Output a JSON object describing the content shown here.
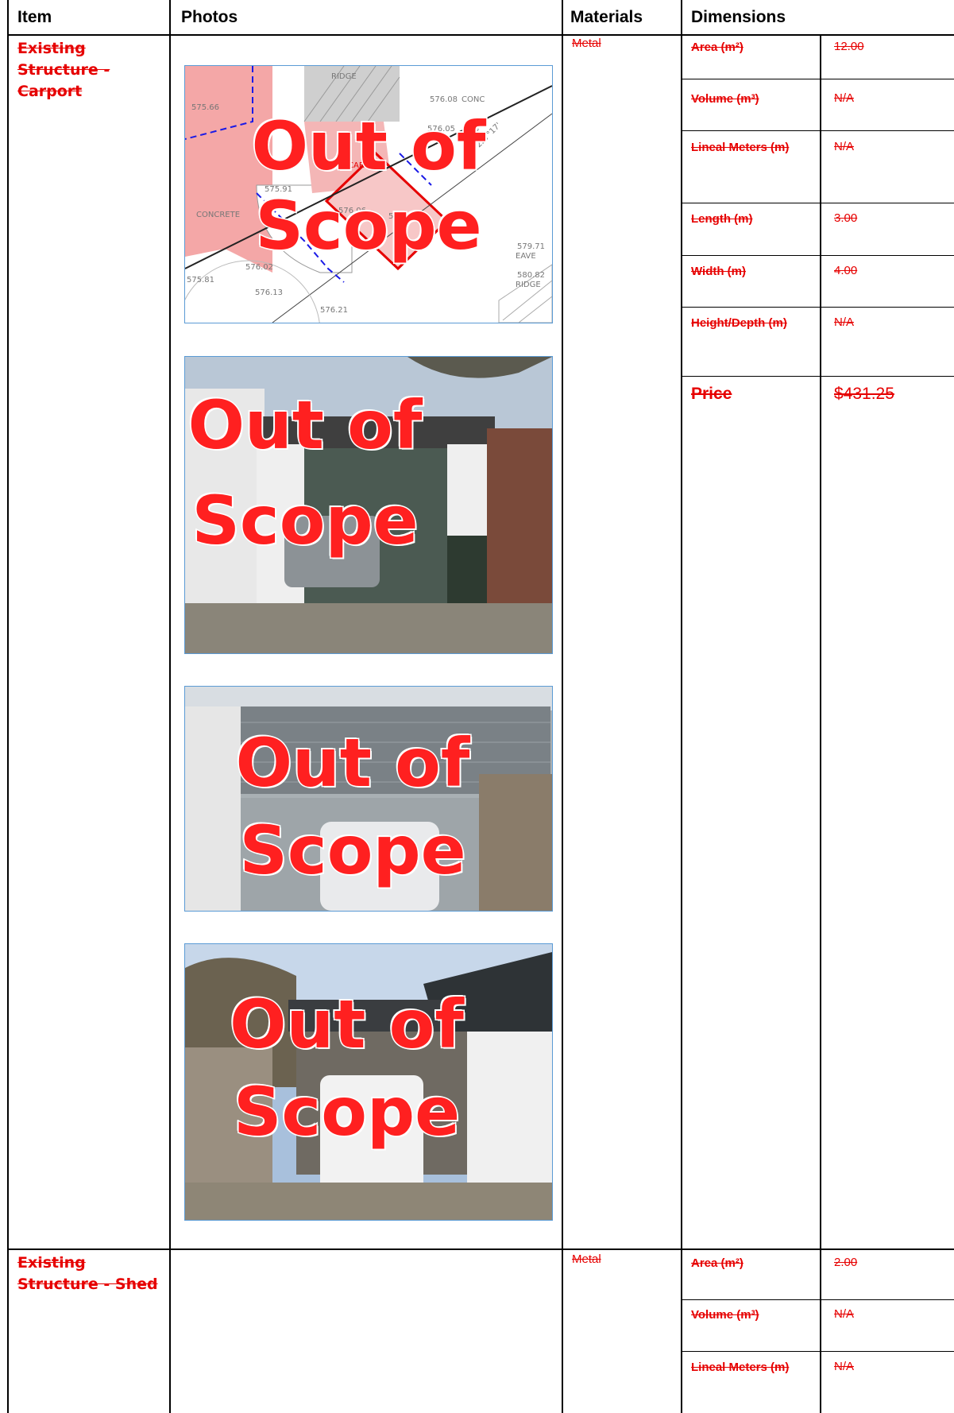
{
  "headers": {
    "item": "Item",
    "photos": "Photos",
    "materials": "Materials",
    "dimensions": "Dimensions"
  },
  "rows": [
    {
      "item": "Existing Structure - Carport",
      "material": "Metal",
      "dims": [
        {
          "label": "Area (m²)",
          "value": "12.00"
        },
        {
          "label": "Volume (m³)",
          "value": "N/A"
        },
        {
          "label": "Lineal Meters (m)",
          "value": "N/A"
        },
        {
          "label": "Length (m)",
          "value": "3.00"
        },
        {
          "label": "Width (m)",
          "value": "4.00"
        },
        {
          "label": "Height/Depth (m)",
          "value": "N/A"
        }
      ],
      "price_label": "Price",
      "price": "$431.25",
      "photo_stamp": [
        "Out of",
        "Scope"
      ]
    },
    {
      "item": "Existing Structure - Shed",
      "material": "Metal",
      "dims": [
        {
          "label": "Area (m²)",
          "value": "2.00"
        },
        {
          "label": "Volume (m³)",
          "value": "N/A"
        },
        {
          "label": "Lineal Meters (m)",
          "value": "N/A"
        }
      ]
    }
  ],
  "plan_labels": {
    "ridge_top": "RIDGE",
    "conc": "CONC",
    "carport": "CARPORT",
    "concrete": "CONCRETE",
    "eave": "EAVE",
    "ridge_right": "RIDGE",
    "w": "W",
    "l1": "575.66",
    "l2": "576.08",
    "l3": "576.05",
    "l4": "575.91",
    "l5": "576.06",
    "l6": "576.14",
    "l7": "576.02",
    "l8": "575.81",
    "l9": "576.13",
    "l10": "576.21",
    "l11": "579.71",
    "l12": "580.82",
    "l13": "30.87",
    "l14": "227°17'"
  },
  "colors": {
    "strike_red": "#e60000",
    "stamp_red": "#ff2020",
    "photo_border": "#5b9bd5"
  }
}
